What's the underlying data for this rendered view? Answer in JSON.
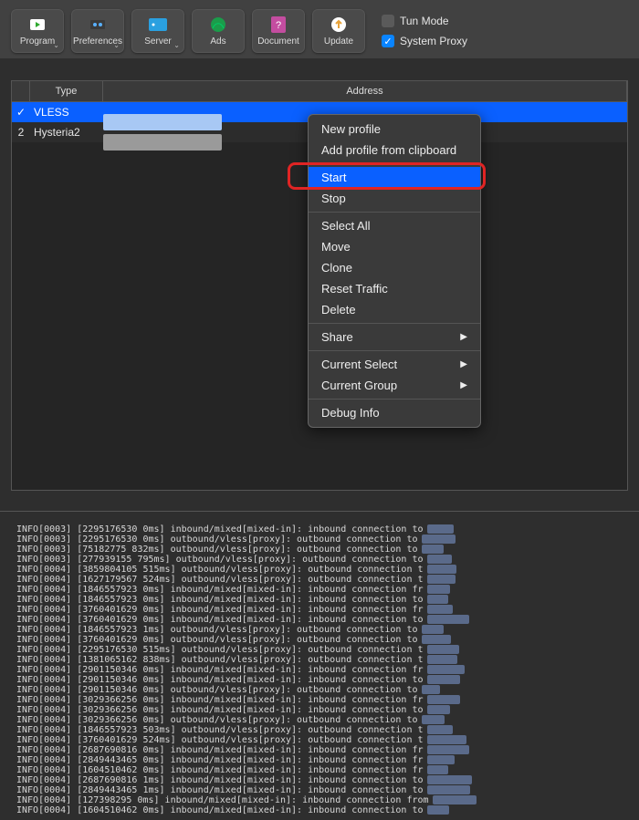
{
  "toolbar": {
    "items": [
      {
        "label": "Program",
        "icon": "program-icon",
        "chev": true
      },
      {
        "label": "Preferences",
        "icon": "prefs-icon",
        "chev": true
      },
      {
        "label": "Server",
        "icon": "server-icon",
        "chev": true
      },
      {
        "label": "Ads",
        "icon": "ads-icon",
        "chev": false
      },
      {
        "label": "Document",
        "icon": "doc-icon",
        "chev": false
      },
      {
        "label": "Update",
        "icon": "update-icon",
        "chev": false
      }
    ],
    "toggles": {
      "tun_label": "Tun Mode",
      "tun_checked": false,
      "proxy_label": "System Proxy",
      "proxy_checked": true
    }
  },
  "table": {
    "headers": {
      "type": "Type",
      "address": "Address"
    },
    "rows": [
      {
        "mark": "✓",
        "type": "VLESS",
        "selected": true
      },
      {
        "mark": "2",
        "type": "Hysteria2",
        "selected": false
      }
    ]
  },
  "context_menu": {
    "groups": [
      [
        {
          "label": "New profile"
        },
        {
          "label": "Add profile from clipboard"
        }
      ],
      [
        {
          "label": "Start",
          "highlight": true
        },
        {
          "label": "Stop"
        }
      ],
      [
        {
          "label": "Select All"
        },
        {
          "label": "Move"
        },
        {
          "label": "Clone"
        },
        {
          "label": "Reset Traffic"
        },
        {
          "label": "Delete"
        }
      ],
      [
        {
          "label": "Share",
          "submenu": true
        }
      ],
      [
        {
          "label": "Current Select",
          "submenu": true
        },
        {
          "label": "Current Group",
          "submenu": true
        }
      ],
      [
        {
          "label": "Debug Info"
        }
      ]
    ]
  },
  "logs": {
    "lines": [
      "INFO[0003] [2295176530 0ms] inbound/mixed[mixed-in]: inbound connection to",
      "INFO[0003] [2295176530 0ms] outbound/vless[proxy]: outbound connection to",
      "INFO[0003] [75182775 832ms] outbound/vless[proxy]: outbound connection to",
      "INFO[0003] [277939155 795ms] outbound/vless[proxy]: outbound connection to",
      "INFO[0004] [3859804105 515ms] outbound/vless[proxy]: outbound connection t",
      "INFO[0004] [1627179567 524ms] outbound/vless[proxy]: outbound connection t",
      "INFO[0004] [1846557923 0ms] inbound/mixed[mixed-in]: inbound connection fr",
      "INFO[0004] [1846557923 0ms] inbound/mixed[mixed-in]: inbound connection to",
      "INFO[0004] [3760401629 0ms] inbound/mixed[mixed-in]: inbound connection fr",
      "INFO[0004] [3760401629 0ms] inbound/mixed[mixed-in]: inbound connection to",
      "INFO[0004] [1846557923 1ms] outbound/vless[proxy]: outbound connection to",
      "INFO[0004] [3760401629 0ms] outbound/vless[proxy]: outbound connection to",
      "INFO[0004] [2295176530 515ms] outbound/vless[proxy]: outbound connection t",
      "INFO[0004] [1381065162 838ms] outbound/vless[proxy]: outbound connection t",
      "INFO[0004] [2901150346 0ms] inbound/mixed[mixed-in]: inbound connection fr",
      "INFO[0004] [2901150346 0ms] inbound/mixed[mixed-in]: inbound connection to",
      "INFO[0004] [2901150346 0ms] outbound/vless[proxy]: outbound connection to",
      "INFO[0004] [3029366256 0ms] inbound/mixed[mixed-in]: inbound connection fr",
      "INFO[0004] [3029366256 0ms] inbound/mixed[mixed-in]: inbound connection to",
      "INFO[0004] [3029366256 0ms] outbound/vless[proxy]: outbound connection to",
      "INFO[0004] [1846557923 503ms] outbound/vless[proxy]: outbound connection t",
      "INFO[0004] [3760401629 524ms] outbound/vless[proxy]: outbound connection t",
      "INFO[0004] [2687690816 0ms] inbound/mixed[mixed-in]: inbound connection fr",
      "INFO[0004] [2849443465 0ms] inbound/mixed[mixed-in]: inbound connection fr",
      "INFO[0004] [1604510462 0ms] inbound/mixed[mixed-in]: inbound connection fr",
      "INFO[0004] [2687690816 1ms] inbound/mixed[mixed-in]: inbound connection to",
      "INFO[0004] [2849443465 1ms] inbound/mixed[mixed-in]: inbound connection to",
      "INFO[0004] [127398295 0ms] inbound/mixed[mixed-in]: inbound connection from",
      "INFO[0004] [1604510462 0ms] inbound/mixed[mixed-in]: inbound connection to"
    ]
  }
}
